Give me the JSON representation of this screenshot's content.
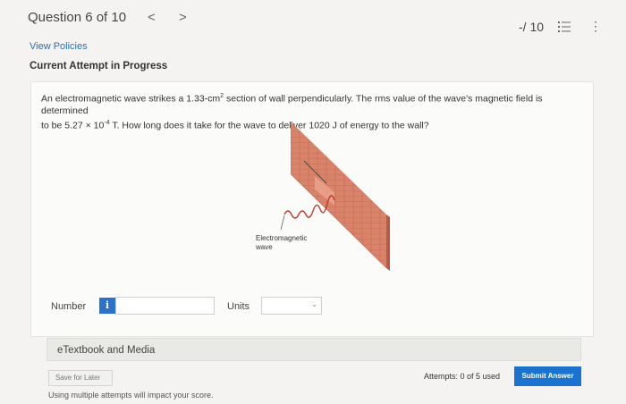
{
  "header": {
    "question_title": "Question 6 of 10",
    "prev_glyph": "<",
    "next_glyph": ">",
    "score": "-/ 10",
    "list_icon": "list-icon",
    "more_glyph": "⋮"
  },
  "policies_link": "View Policies",
  "attempt_status": "Current Attempt in Progress",
  "question": {
    "line1_pre": "An electromagnetic wave strikes a 1.33-cm",
    "line1_sup": "2",
    "line1_post": " section of wall perpendicularly. The rms value of the wave's magnetic field is determined",
    "line2_pre": "to be 5.27 × 10",
    "line2_sup": "-4",
    "line2_post": " T. How long does it take for the wave to deliver 1020 J of energy to the wall?"
  },
  "figure": {
    "label_line1": "Electromagnetic",
    "label_line2": "wave",
    "wall_color": "#d9846a",
    "wave_color": "#c0392b"
  },
  "answer": {
    "number_label": "Number",
    "info_glyph": "i",
    "number_value": "",
    "units_label": "Units",
    "units_value": "",
    "units_chevron": "⌄"
  },
  "etextbook": "eTextbook and Media",
  "footer": {
    "save_later": "Save for Later",
    "attempts": "Attempts: 0 of 5 used",
    "submit": "Submit Answer",
    "note": "Using multiple attempts will impact your score."
  },
  "colors": {
    "accent": "#1a73d1",
    "link": "#2a6fb3"
  }
}
